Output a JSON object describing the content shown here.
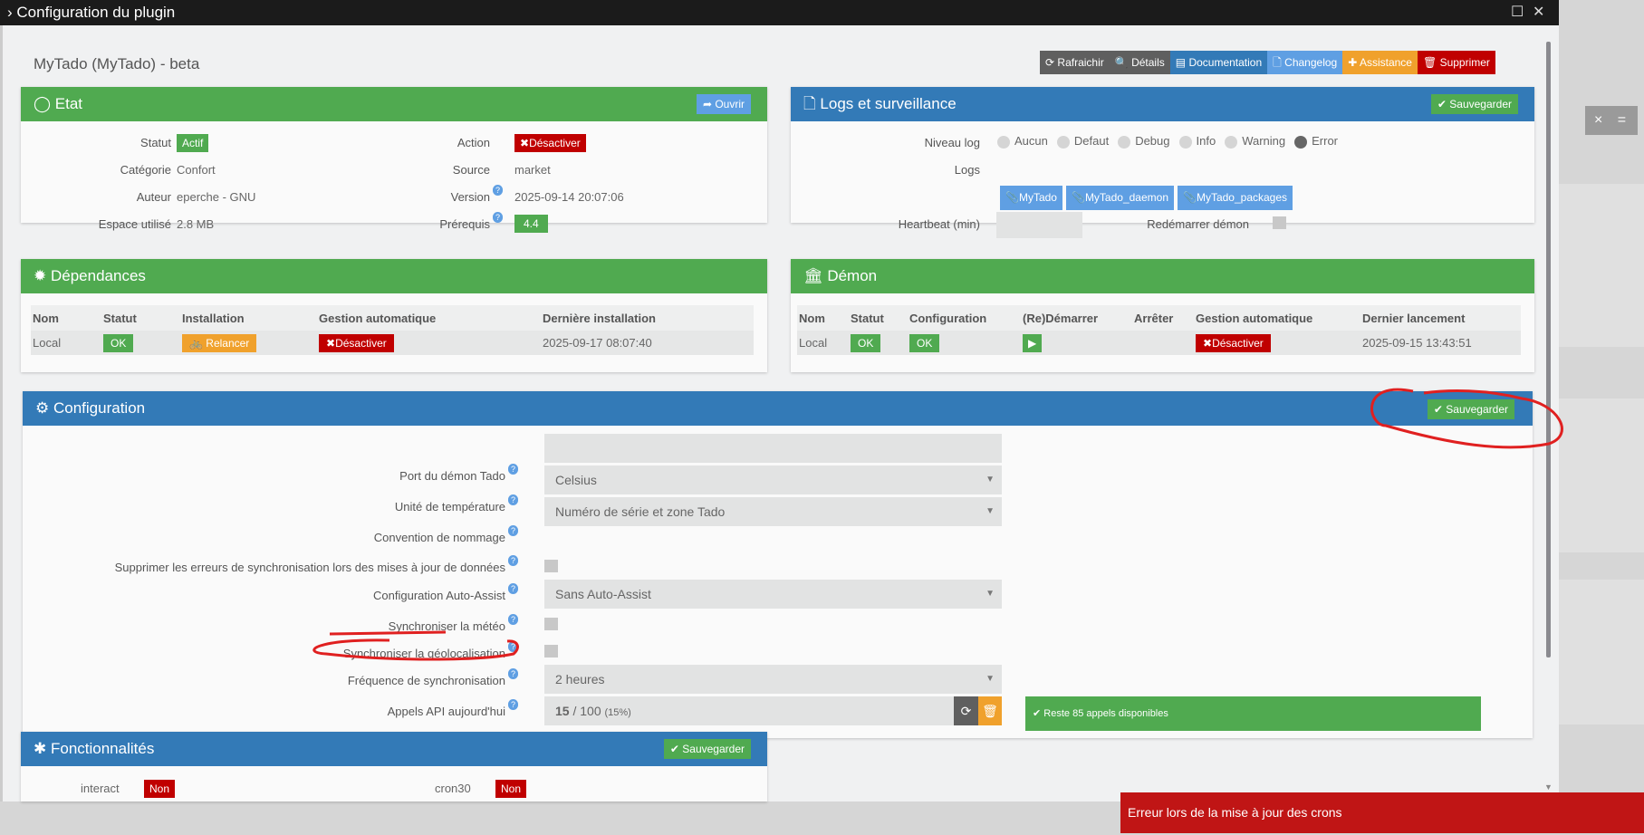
{
  "window": {
    "title": "Configuration du plugin"
  },
  "plugin": {
    "title": "MyTado (MyTado) - beta"
  },
  "toolbar": [
    {
      "label": "Rafraichir",
      "icon": "refresh-icon",
      "color": "#5f5f5f"
    },
    {
      "label": "Détails",
      "icon": "search-icon",
      "color": "#5f5f5f"
    },
    {
      "label": "Documentation",
      "icon": "book-icon",
      "color": "#337ab7"
    },
    {
      "label": "Changelog",
      "icon": "file-icon",
      "color": "#5f9fe3"
    },
    {
      "label": "Assistance",
      "icon": "ambulance-icon",
      "color": "#f0a12c"
    },
    {
      "label": "Supprimer",
      "icon": "trash-icon",
      "color": "#c00000"
    }
  ],
  "etat": {
    "title": "Etat",
    "open": "Ouvrir",
    "statut_label": "Statut",
    "statut": "Actif",
    "categorie_label": "Catégorie",
    "categorie": "Confort",
    "auteur_label": "Auteur",
    "auteur": "eperche - GNU",
    "espace_label": "Espace utilisé",
    "espace": "2.8 MB",
    "action_label": "Action",
    "action": "Désactiver",
    "source_label": "Source",
    "source": "market",
    "version_label": "Version",
    "version": "2025-09-14 20:07:06",
    "prerequis_label": "Prérequis",
    "prerequis": "4.4"
  },
  "logs": {
    "title": "Logs et surveillance",
    "save": "Sauvegarder",
    "niveau_label": "Niveau log",
    "levels": [
      "Aucun",
      "Defaut",
      "Debug",
      "Info",
      "Warning",
      "Error"
    ],
    "selected_level": "Error",
    "logs_label": "Logs",
    "log_buttons": [
      "MyTado",
      "MyTado_daemon",
      "MyTado_packages"
    ],
    "heartbeat_label": "Heartbeat (min)",
    "heartbeat": "",
    "restart_label": "Redémarrer démon"
  },
  "deps": {
    "title": "Dépendances",
    "headers": [
      "Nom",
      "Statut",
      "Installation",
      "Gestion automatique",
      "Dernière installation"
    ],
    "row": {
      "nom": "Local",
      "statut": "OK",
      "installation": "Relancer",
      "gestion": "Désactiver",
      "date": "2025-09-17 08:07:40"
    }
  },
  "demon": {
    "title": "Démon",
    "headers": [
      "Nom",
      "Statut",
      "Configuration",
      "(Re)Démarrer",
      "Arrêter",
      "Gestion automatique",
      "Dernier lancement"
    ],
    "row": {
      "nom": "Local",
      "statut": "OK",
      "configuration": "OK",
      "gestion": "Désactiver",
      "date": "2025-09-15 13:43:51"
    }
  },
  "config": {
    "title": "Configuration",
    "save": "Sauvegarder",
    "port_label": "Port du démon Tado",
    "port": "",
    "unit_label": "Unité de température",
    "unit": "Celsius",
    "naming_label": "Convention de nommage",
    "naming": "Numéro de série et zone Tado",
    "suppress_label": "Supprimer les erreurs de synchronisation lors des mises à jour de données",
    "autoassist_label": "Configuration Auto-Assist",
    "autoassist": "Sans Auto-Assist",
    "meteo_label": "Synchroniser la météo",
    "geo_label": "Synchroniser la géolocalisation",
    "freq_label": "Fréquence de synchronisation",
    "freq": "2 heures",
    "api_label": "Appels API aujourd'hui",
    "api_used": "15",
    "api_total": "/ 100",
    "api_pct": "(15%)",
    "api_msg": "Reste 85 appels disponibles"
  },
  "features": {
    "title": "Fonctionnalités",
    "save": "Sauvegarder",
    "items": [
      {
        "label": "interact",
        "value": "Non"
      },
      {
        "label": "cron30",
        "value": "Non"
      }
    ]
  },
  "notification": {
    "text": "Erreur lors de la mise à jour des crons"
  },
  "background": {
    "close": "×",
    "menu": "="
  }
}
